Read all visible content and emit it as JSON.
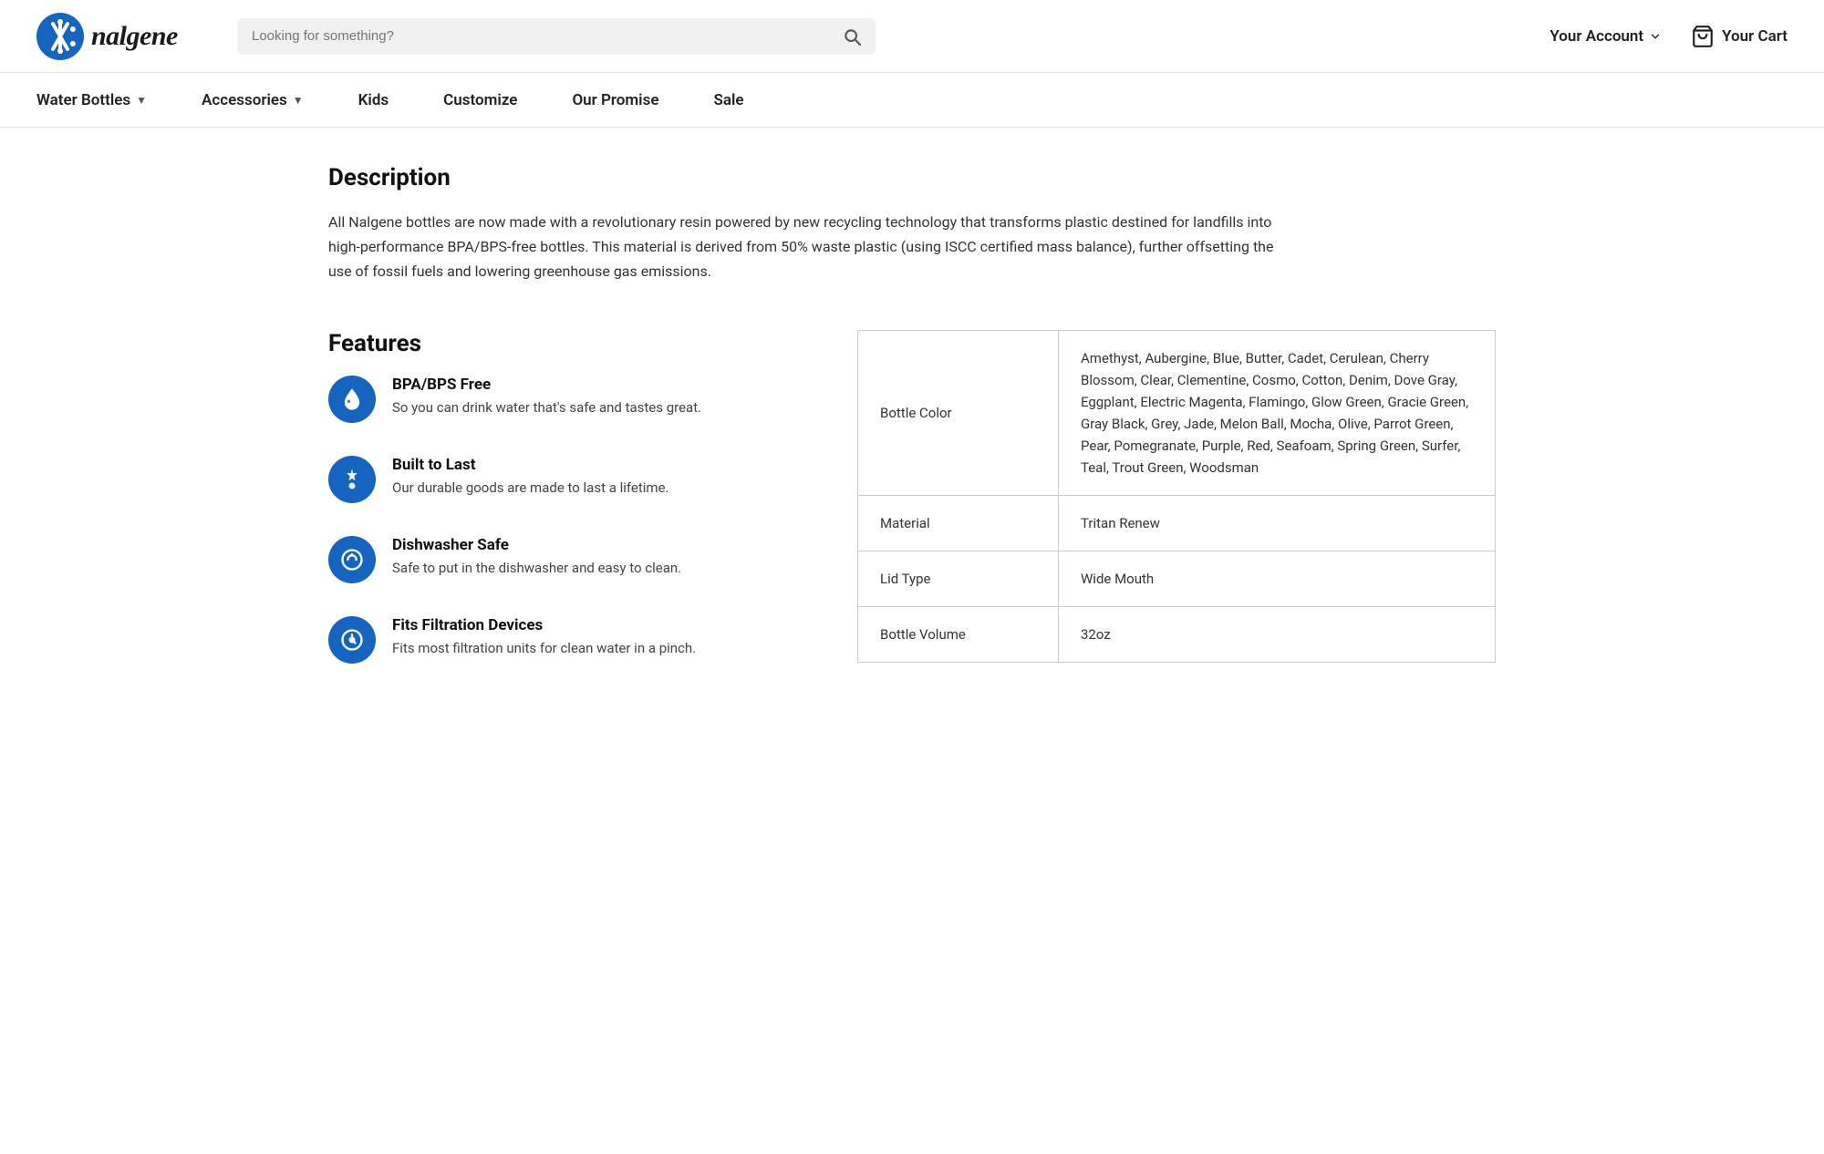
{
  "header": {
    "logo_text": "nalgene",
    "search_placeholder": "Looking for something?",
    "account_label": "Your Account",
    "cart_label": "Your Cart"
  },
  "nav": {
    "items": [
      {
        "label": "Water Bottles",
        "has_dropdown": true
      },
      {
        "label": "Accessories",
        "has_dropdown": true
      },
      {
        "label": "Kids",
        "has_dropdown": false
      },
      {
        "label": "Customize",
        "has_dropdown": false
      },
      {
        "label": "Our Promise",
        "has_dropdown": false
      },
      {
        "label": "Sale",
        "has_dropdown": false
      }
    ]
  },
  "description": {
    "title": "Description",
    "text": "All Nalgene bottles are now made with a revolutionary resin powered by new recycling technology that transforms plastic destined for landfills into high-performance BPA/BPS-free bottles. This material is derived from 50% waste plastic (using ISCC certified mass balance), further offsetting the use of fossil fuels and lowering greenhouse gas emissions."
  },
  "features": {
    "title": "Features",
    "items": [
      {
        "icon": "💧",
        "title": "BPA/BPS Free",
        "desc": "So you can drink water that's safe and tastes great."
      },
      {
        "icon": "♻",
        "title": "Built to Last",
        "desc": "Our durable goods are made to last a lifetime."
      },
      {
        "icon": "🍽",
        "title": "Dishwasher Safe",
        "desc": "Safe to put in the dishwasher and easy to clean."
      },
      {
        "icon": "🔬",
        "title": "Fits Filtration Devices",
        "desc": "Fits most filtration units for clean water in a pinch."
      }
    ]
  },
  "specs": {
    "rows": [
      {
        "label": "Bottle Color",
        "value": "Amethyst, Aubergine, Blue, Butter, Cadet, Cerulean, Cherry Blossom, Clear, Clementine, Cosmo, Cotton, Denim, Dove Gray, Eggplant, Electric Magenta, Flamingo, Glow Green, Gracie Green, Gray Black, Grey, Jade, Melon Ball, Mocha, Olive, Parrot Green, Pear, Pomegranate, Purple, Red, Seafoam, Spring Green, Surfer, Teal, Trout Green, Woodsman"
      },
      {
        "label": "Material",
        "value": "Tritan Renew"
      },
      {
        "label": "Lid Type",
        "value": "Wide Mouth"
      },
      {
        "label": "Bottle Volume",
        "value": "32oz"
      }
    ]
  }
}
